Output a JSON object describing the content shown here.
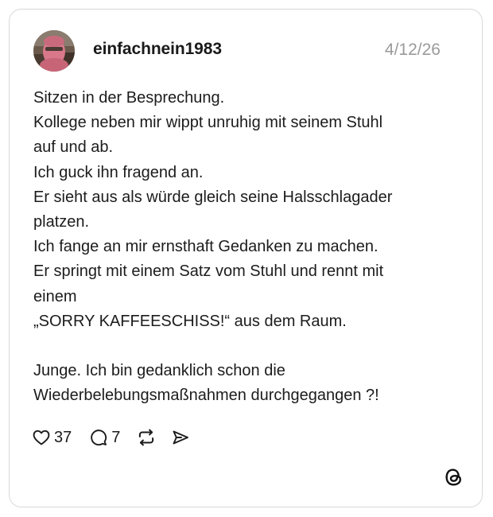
{
  "post": {
    "username": "einfachnein1983",
    "timestamp": "4/12/26",
    "lines": [
      "Sitzen in der Besprechung.",
      "Kollege neben mir wippt unruhig mit seinem Stuhl",
      "auf und ab.",
      "Ich guck ihn fragend an.",
      "Er sieht aus als würde gleich seine Halsschlagader",
      "platzen.",
      "Ich fange an mir ernsthaft Gedanken zu machen.",
      "Er springt mit einem Satz vom Stuhl und rennt mit",
      "einem",
      "„SORRY KAFFEESCHISS!“ aus dem Raum.",
      "",
      "Junge. Ich bin gedanklich schon die",
      "Wiederbelebungsmaßnahmen durchgegangen ?!"
    ]
  },
  "actions": {
    "like_count": "37",
    "reply_count": "7",
    "icons": [
      "heart-icon",
      "comment-icon",
      "repost-icon",
      "share-icon"
    ]
  },
  "brand": {
    "logo": "threads-logo-icon"
  },
  "colors": {
    "text": "#1c1c1c",
    "muted": "#9a9a9a",
    "border": "#d9d9d9",
    "avatar_mask": "#d8788a"
  }
}
